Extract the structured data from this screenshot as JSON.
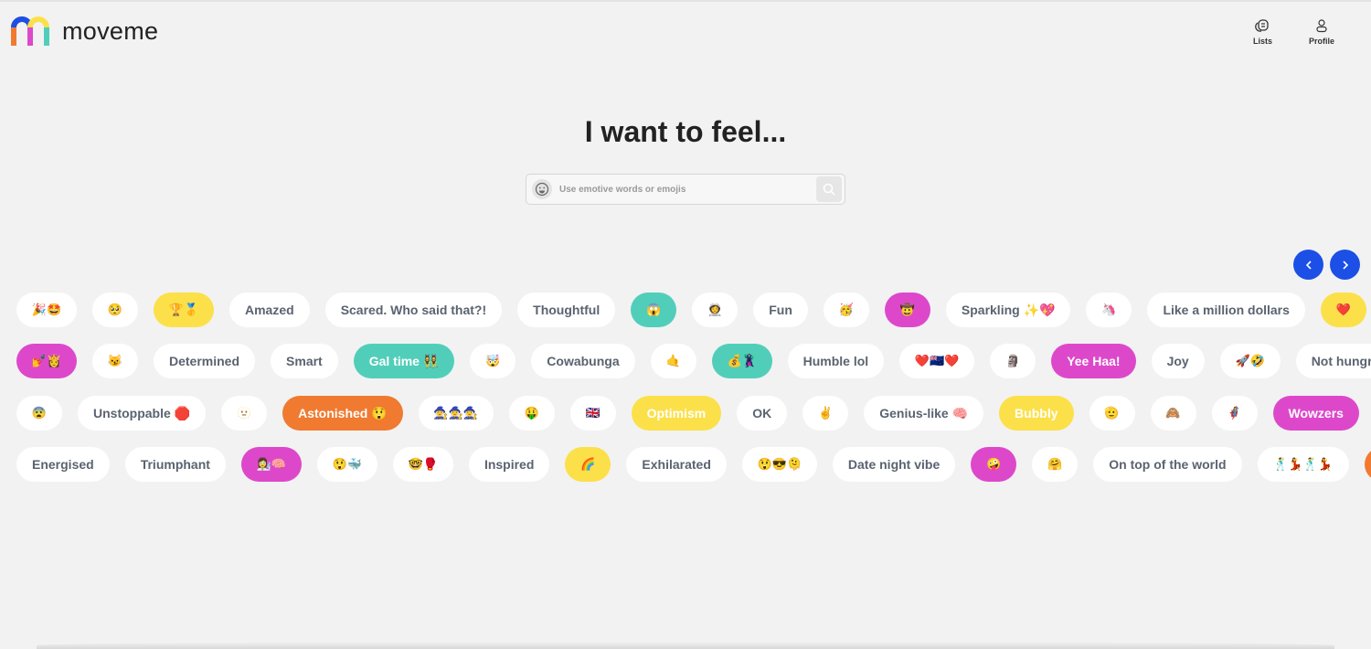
{
  "brand": {
    "name": "moveme",
    "colors": [
      "#f07a30",
      "#1c4fe6",
      "#dd48cb",
      "#fbe04a",
      "#51ceb9"
    ]
  },
  "nav": {
    "lists": "Lists",
    "profile": "Profile",
    "lists_icon": "lists-icon",
    "profile_icon": "person-icon"
  },
  "hero": {
    "title": "I want to feel..."
  },
  "search": {
    "placeholder": "Use emotive words or emojis",
    "value": ""
  },
  "carousel": {
    "prev_icon": "chevron-left-icon",
    "next_icon": "chevron-right-icon",
    "accent": "#1c4fe6"
  },
  "rows": [
    [
      {
        "t": "🎉🤩",
        "c": "white",
        "e": 1
      },
      {
        "t": "🥺",
        "c": "white",
        "e": 1
      },
      {
        "t": "🏆🥇",
        "c": "yellow",
        "e": 1
      },
      {
        "t": "Amazed",
        "c": "white"
      },
      {
        "t": "Scared. Who said that?!",
        "c": "white"
      },
      {
        "t": "Thoughtful",
        "c": "white"
      },
      {
        "t": "😱",
        "c": "teal",
        "e": 1
      },
      {
        "t": "👩‍🚀",
        "c": "white",
        "e": 1
      },
      {
        "t": "Fun",
        "c": "white"
      },
      {
        "t": "🥳",
        "c": "white",
        "e": 1
      },
      {
        "t": "🤠",
        "c": "magenta",
        "e": 1
      },
      {
        "t": "Sparkling ✨💖",
        "c": "white"
      },
      {
        "t": "🦄",
        "c": "white",
        "e": 1
      },
      {
        "t": "Like a million dollars",
        "c": "white"
      },
      {
        "t": "❤️",
        "c": "yellow",
        "e": 1
      }
    ],
    [
      {
        "t": "💅👸",
        "c": "magenta",
        "e": 1
      },
      {
        "t": "😼",
        "c": "white",
        "e": 1
      },
      {
        "t": "Determined",
        "c": "white"
      },
      {
        "t": "Smart",
        "c": "white"
      },
      {
        "t": "Gal time 👯‍♀️",
        "c": "teal"
      },
      {
        "t": "🤯",
        "c": "white",
        "e": 1
      },
      {
        "t": "Cowabunga",
        "c": "white"
      },
      {
        "t": "🤙",
        "c": "white",
        "e": 1
      },
      {
        "t": "💰🦹‍♀️",
        "c": "teal",
        "e": 1
      },
      {
        "t": "Humble lol",
        "c": "white"
      },
      {
        "t": "❤️🇳🇿❤️",
        "c": "white",
        "e": 1
      },
      {
        "t": "🗿",
        "c": "white",
        "e": 1
      },
      {
        "t": "Yee Haa!",
        "c": "magenta"
      },
      {
        "t": "Joy",
        "c": "white"
      },
      {
        "t": "🚀🤣",
        "c": "white",
        "e": 1
      },
      {
        "t": "Not hungry",
        "c": "white"
      }
    ],
    [
      {
        "t": "😨",
        "c": "white",
        "e": 1
      },
      {
        "t": "Unstoppable 🛑",
        "c": "white"
      },
      {
        "t": "🫥",
        "c": "white",
        "e": 1
      },
      {
        "t": "Astonished 😲",
        "c": "orange"
      },
      {
        "t": "🧙‍♀️🧙‍♀️🧙‍♀️",
        "c": "white",
        "e": 1
      },
      {
        "t": "🤑",
        "c": "white",
        "e": 1
      },
      {
        "t": "🇬🇧",
        "c": "white",
        "e": 1
      },
      {
        "t": "Optimism",
        "c": "yellow"
      },
      {
        "t": "OK",
        "c": "white"
      },
      {
        "t": "✌️",
        "c": "white",
        "e": 1
      },
      {
        "t": "Genius-like 🧠",
        "c": "white"
      },
      {
        "t": "Bubbly",
        "c": "yellow"
      },
      {
        "t": "🫡",
        "c": "white",
        "e": 1
      },
      {
        "t": "🙈",
        "c": "white",
        "e": 1
      },
      {
        "t": "🦸‍♀️",
        "c": "white",
        "e": 1
      },
      {
        "t": "Wowzers",
        "c": "magenta"
      },
      {
        "t": "",
        "c": "white",
        "e": 1
      }
    ],
    [
      {
        "t": "Energised",
        "c": "white"
      },
      {
        "t": "Triumphant",
        "c": "white"
      },
      {
        "t": "👩‍🔬🧠",
        "c": "magenta",
        "e": 1
      },
      {
        "t": "😲🐳",
        "c": "white",
        "e": 1
      },
      {
        "t": "🤓🥊",
        "c": "white",
        "e": 1
      },
      {
        "t": "Inspired",
        "c": "white"
      },
      {
        "t": "🌈",
        "c": "yellow",
        "e": 1
      },
      {
        "t": "Exhilarated",
        "c": "white"
      },
      {
        "t": "😲😎🫠",
        "c": "white",
        "e": 1
      },
      {
        "t": "Date night vibe",
        "c": "white"
      },
      {
        "t": "🤪",
        "c": "magenta",
        "e": 1
      },
      {
        "t": "🤗",
        "c": "white",
        "e": 1
      },
      {
        "t": "On top of the world",
        "c": "white"
      },
      {
        "t": "🕺💃🕺💃",
        "c": "white",
        "e": 1
      },
      {
        "t": "",
        "c": "orange",
        "e": 1
      }
    ]
  ]
}
